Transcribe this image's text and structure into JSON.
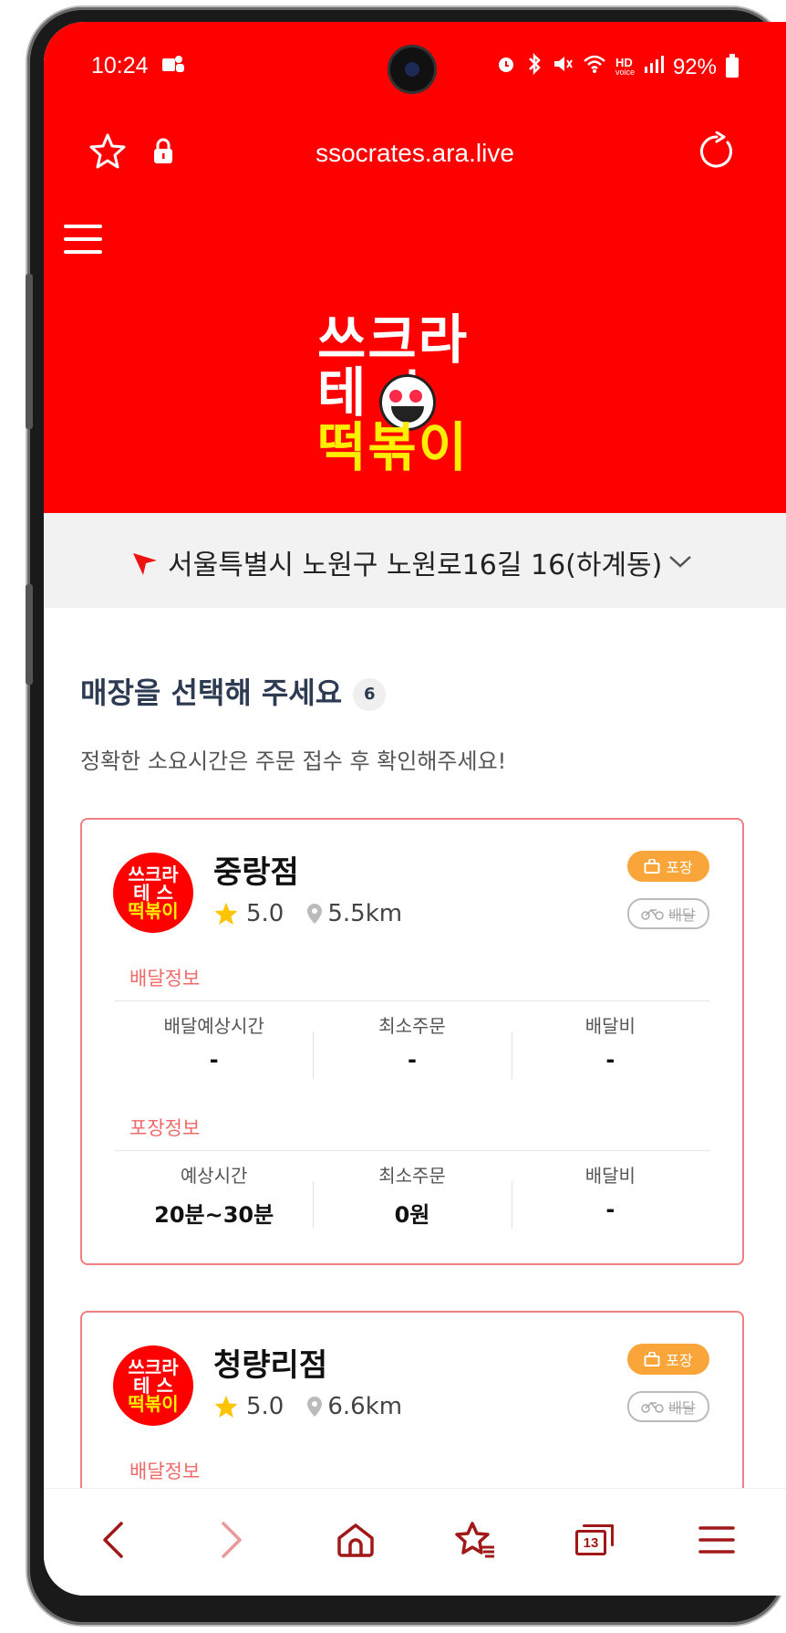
{
  "status_bar": {
    "time": "10:24",
    "battery": "92%",
    "notification_icons": [
      "teams-icon"
    ],
    "right_icons": [
      "alarm-icon",
      "bluetooth-icon",
      "mute-icon",
      "wifi-icon",
      "hd-voice-icon",
      "signal-icon"
    ],
    "hd_label": "HD",
    "voice_label": "voice"
  },
  "browser": {
    "url": "ssocrates.ara.live"
  },
  "logo": {
    "line1": "쓰크라",
    "line2": "테  스",
    "line3": "떡볶이"
  },
  "address": {
    "text": "서울특별시 노원구 노원로16길 16(하계동)"
  },
  "main": {
    "title": "매장을 선택해 주세요",
    "store_count": "6",
    "subtitle": "정확한 소요시간은 주문 접수 후 확인해주세요!"
  },
  "stores": [
    {
      "name": "중랑점",
      "rating": "5.0",
      "distance": "5.5km",
      "pickup_badge": "포장",
      "delivery_badge": "배달",
      "delivery_section": "배달정보",
      "delivery_cols": [
        {
          "label": "배달예상시간",
          "value": "-"
        },
        {
          "label": "최소주문",
          "value": "-"
        },
        {
          "label": "배달비",
          "value": "-"
        }
      ],
      "pickup_section": "포장정보",
      "pickup_cols": [
        {
          "label": "예상시간",
          "value": "20분~30분"
        },
        {
          "label": "최소주문",
          "value": "0원"
        },
        {
          "label": "배달비",
          "value": "-"
        }
      ]
    },
    {
      "name": "청량리점",
      "rating": "5.0",
      "distance": "6.6km",
      "pickup_badge": "포장",
      "delivery_badge": "배달",
      "delivery_section": "배달정보"
    }
  ],
  "bottom_nav": {
    "tab_count": "13",
    "icons": [
      "back-icon",
      "forward-icon",
      "home-icon",
      "bookmarks-icon",
      "tabs-icon",
      "menu-icon"
    ]
  },
  "colors": {
    "brand_red": "#ff0000",
    "logo_yellow": "#ffee00",
    "pickup_orange": "#f9a53a",
    "section_label": "#f06a6a",
    "nav_icon": "#a01818"
  }
}
